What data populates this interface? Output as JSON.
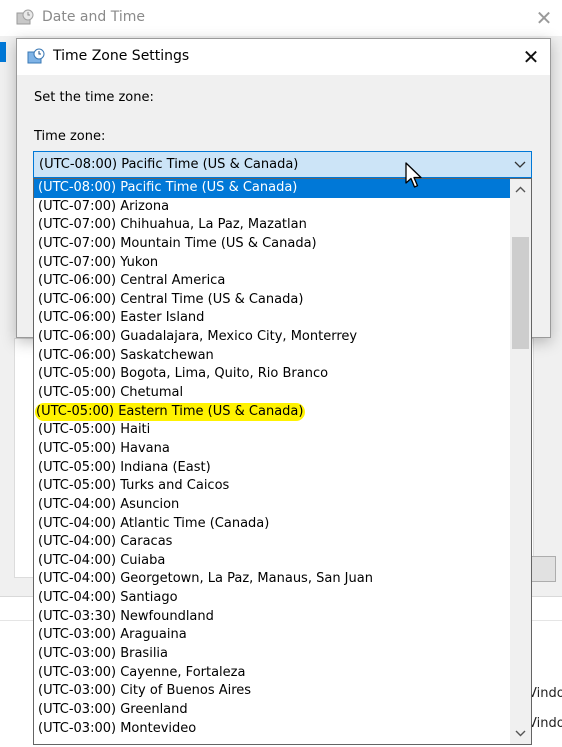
{
  "background_window": {
    "title": "Date and Time",
    "side_text_1": "Vindo",
    "side_text_2": "Vindo"
  },
  "dialog": {
    "title": "Time Zone Settings",
    "set_label": "Set the time zone:",
    "timezone_label": "Time zone:"
  },
  "combo": {
    "selected": "(UTC-08:00) Pacific Time (US & Canada)"
  },
  "dropdown": {
    "selected_index": 0,
    "highlighted_index": 12,
    "highlight_color": "#fff200",
    "items": [
      "(UTC-08:00) Pacific Time (US & Canada)",
      "(UTC-07:00) Arizona",
      "(UTC-07:00) Chihuahua, La Paz, Mazatlan",
      "(UTC-07:00) Mountain Time (US & Canada)",
      "(UTC-07:00) Yukon",
      "(UTC-06:00) Central America",
      "(UTC-06:00) Central Time (US & Canada)",
      "(UTC-06:00) Easter Island",
      "(UTC-06:00) Guadalajara, Mexico City, Monterrey",
      "(UTC-06:00) Saskatchewan",
      "(UTC-05:00) Bogota, Lima, Quito, Rio Branco",
      "(UTC-05:00) Chetumal",
      "(UTC-05:00) Eastern Time (US & Canada)",
      "(UTC-05:00) Haiti",
      "(UTC-05:00) Havana",
      "(UTC-05:00) Indiana (East)",
      "(UTC-05:00) Turks and Caicos",
      "(UTC-04:00) Asuncion",
      "(UTC-04:00) Atlantic Time (Canada)",
      "(UTC-04:00) Caracas",
      "(UTC-04:00) Cuiaba",
      "(UTC-04:00) Georgetown, La Paz, Manaus, San Juan",
      "(UTC-04:00) Santiago",
      "(UTC-03:30) Newfoundland",
      "(UTC-03:00) Araguaina",
      "(UTC-03:00) Brasilia",
      "(UTC-03:00) Cayenne, Fortaleza",
      "(UTC-03:00) City of Buenos Aires",
      "(UTC-03:00) Greenland",
      "(UTC-03:00) Montevideo"
    ]
  },
  "icons": {
    "window_icon": "globe-clock-icon",
    "close": "close-icon",
    "dropdown_arrow": "chevron-down-icon",
    "scroll_up": "chevron-up-icon",
    "scroll_down": "chevron-down-icon",
    "cursor": "mouse-pointer-icon"
  },
  "colors": {
    "selection": "#0078d7",
    "combo_bg": "#cce4f7"
  }
}
